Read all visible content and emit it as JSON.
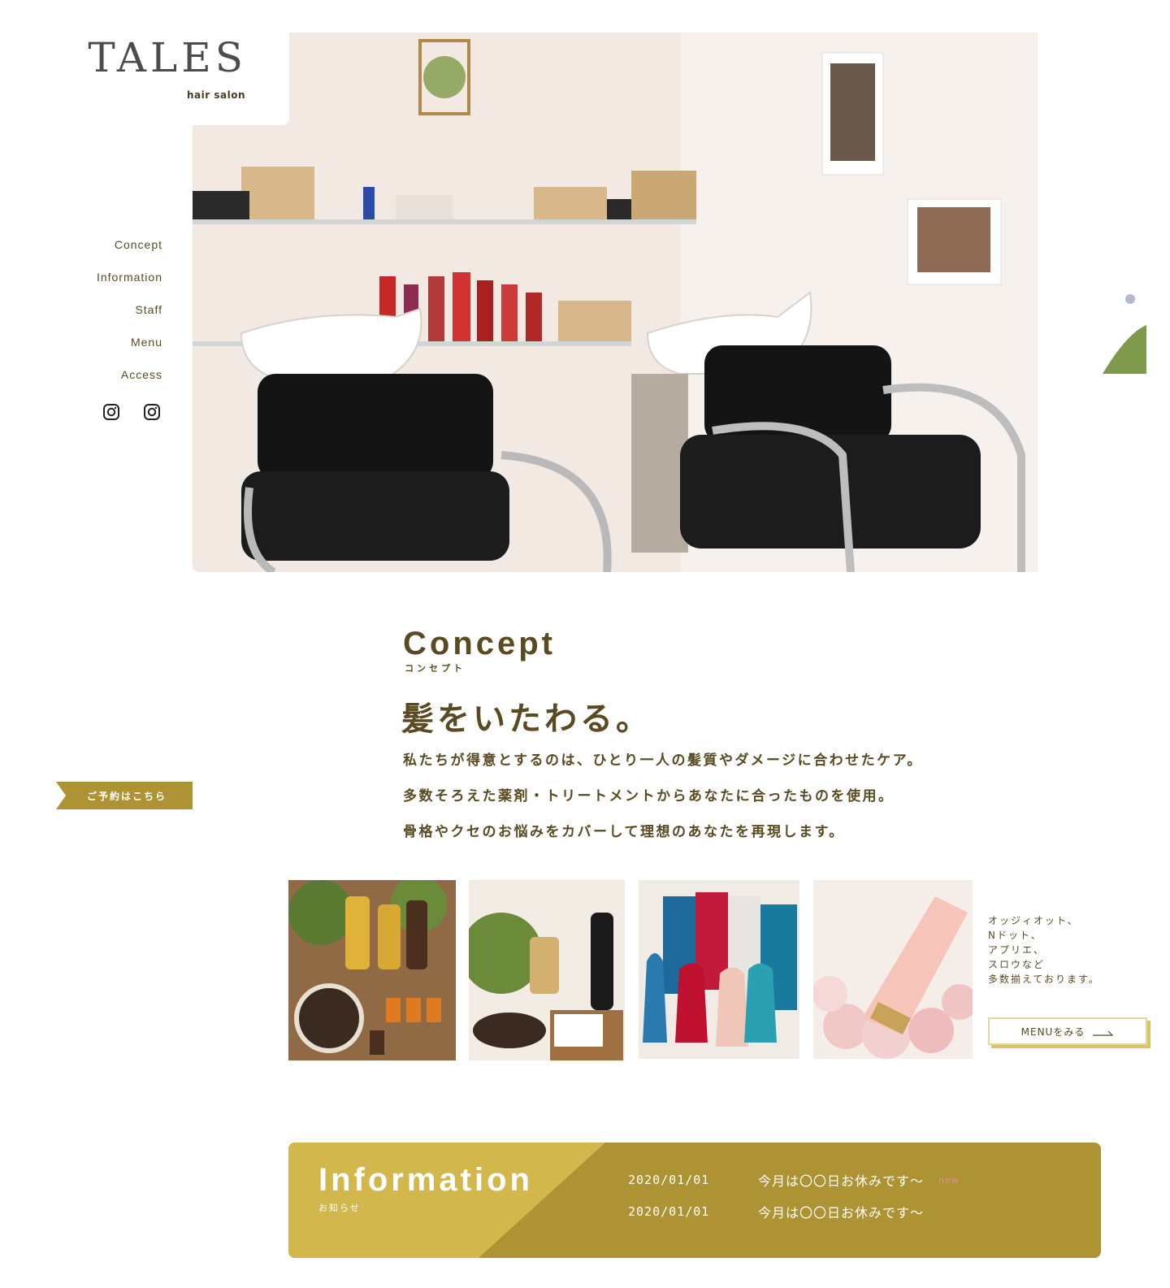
{
  "logo": {
    "title": "TALES",
    "subtitle": "hair salon"
  },
  "nav": {
    "items": [
      {
        "label": "Concept"
      },
      {
        "label": "Information"
      },
      {
        "label": "Staff"
      },
      {
        "label": "Menu"
      },
      {
        "label": "Access"
      }
    ],
    "social_icons": [
      "instagram-icon",
      "instagram-icon"
    ]
  },
  "hero": {
    "slide_count": 3,
    "active_slide": 1
  },
  "reserve": {
    "label": "ご予約はこちら"
  },
  "concept": {
    "heading": "Concept",
    "kana": "コンセプト",
    "lead": "髪をいたわる。",
    "paragraphs": [
      "私たちが得意とするのは、ひとり一人の髪質やダメージに合わせたケア。",
      "多数そろえた薬剤・トリートメントからあなたに合ったものを使用。",
      "骨格やクセのお悩みをカバーして理想のあなたを再現します。"
    ]
  },
  "products": {
    "lines": [
      "オッジィオット、",
      "Nドット、",
      "アプリエ、",
      "スロウなど",
      "多数揃えております。"
    ],
    "menu_button": "MENUをみる"
  },
  "information": {
    "title": "Information",
    "kana": "お知らせ",
    "news": [
      {
        "date": "2020/01/01",
        "text": "今月は〇〇日お休みです〜",
        "badge": "new"
      },
      {
        "date": "2020/01/01",
        "text": "今月は〇〇日お休みです〜",
        "badge": ""
      }
    ]
  },
  "colors": {
    "accent": "#ad9334",
    "accent_light": "#d2b84c",
    "text": "#5a4a22",
    "badge": "#e6899a"
  }
}
